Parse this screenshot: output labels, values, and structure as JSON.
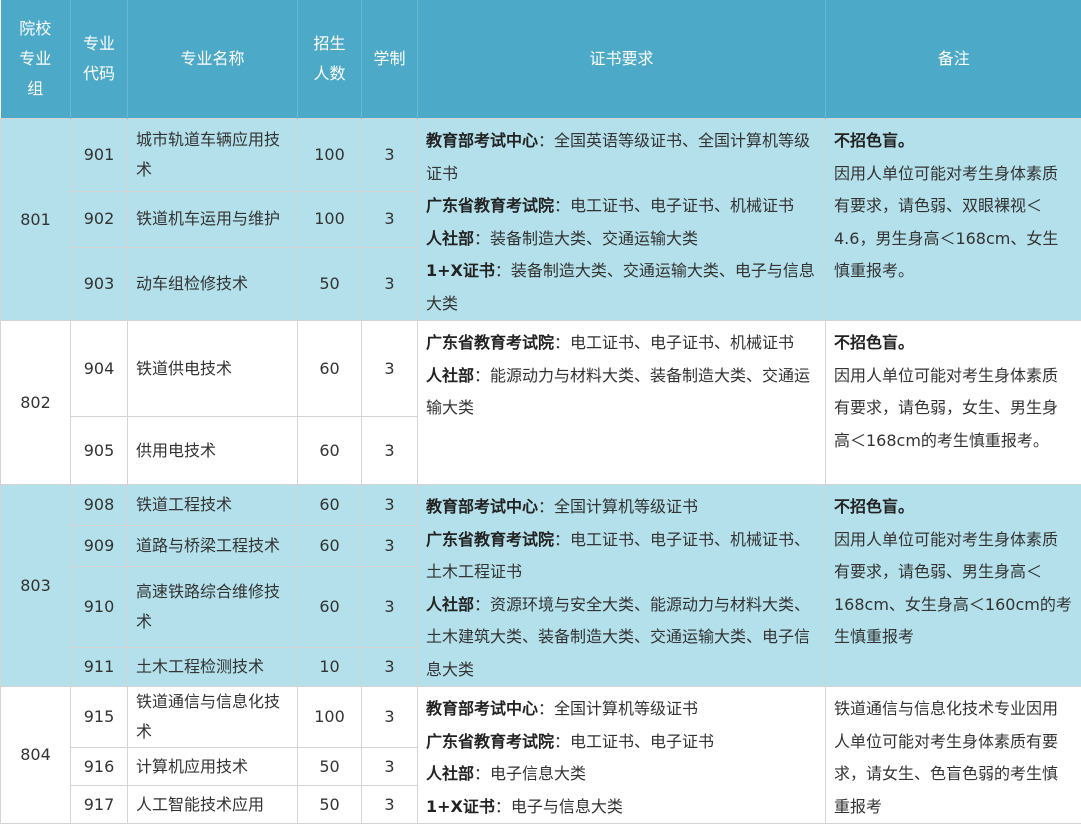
{
  "headers": {
    "group": [
      "院校",
      "专业",
      "组"
    ],
    "code": [
      "专业",
      "代码"
    ],
    "name": "专业名称",
    "enroll": [
      "招生",
      "人数"
    ],
    "years": "学制",
    "cert": "证书要求",
    "note": "备注"
  },
  "groups": [
    {
      "id": "801",
      "majors": [
        {
          "code": "901",
          "name": "城市轨道车辆应用技术",
          "count": "100",
          "years": "3"
        },
        {
          "code": "902",
          "name": "铁道机车运用与维护",
          "count": "100",
          "years": "3"
        },
        {
          "code": "903",
          "name": "动车组检修技术",
          "count": "50",
          "years": "3"
        }
      ],
      "cert": [
        {
          "label": "教育部考试中心",
          "text": "：全国英语等级证书、全国计算机等级证书"
        },
        {
          "label": "广东省教育考试院",
          "text": "：电工证书、电子证书、机械证书"
        },
        {
          "label": "人社部",
          "text": "：装备制造大类、交通运输大类"
        },
        {
          "label": "1+X证书",
          "text": "：装备制造大类、交通运输大类、电子与信息大类"
        }
      ],
      "note_bold": "不招色盲。",
      "note": "因用人单位可能对考生身体素质有要求，请色弱、双眼裸视＜4.6，男生身高＜168cm、女生慎重报考。"
    },
    {
      "id": "802",
      "majors": [
        {
          "code": "904",
          "name": "铁道供电技术",
          "count": "60",
          "years": "3"
        },
        {
          "code": "905",
          "name": "供用电技术",
          "count": "60",
          "years": "3"
        }
      ],
      "cert": [
        {
          "label": "广东省教育考试院",
          "text": "：电工证书、电子证书、机械证书"
        },
        {
          "label": "人社部",
          "text": "：能源动力与材料大类、装备制造大类、交通运输大类"
        }
      ],
      "note_bold": "不招色盲。",
      "note": "因用人单位可能对考生身体素质有要求，请色弱，女生、男生身高＜168cm的考生慎重报考。"
    },
    {
      "id": "803",
      "majors": [
        {
          "code": "908",
          "name": "铁道工程技术",
          "count": "60",
          "years": "3"
        },
        {
          "code": "909",
          "name": "道路与桥梁工程技术",
          "count": "60",
          "years": "3"
        },
        {
          "code": "910",
          "name": "高速铁路综合维修技术",
          "count": "60",
          "years": "3"
        },
        {
          "code": "911",
          "name": "土木工程检测技术",
          "count": "10",
          "years": "3"
        }
      ],
      "cert": [
        {
          "label": "教育部考试中心",
          "text": "：全国计算机等级证书"
        },
        {
          "label": "广东省教育考试院",
          "text": "：电工证书、电子证书、机械证书、土木工程证书"
        },
        {
          "label": "人社部",
          "text": "：资源环境与安全大类、能源动力与材料大类、土木建筑大类、装备制造大类、交通运输大类、电子信息大类"
        }
      ],
      "note_bold": "不招色盲。",
      "note": "因用人单位可能对考生身体素质有要求，请色弱、男生身高＜168cm、女生身高＜160cm的考生慎重报考"
    },
    {
      "id": "804",
      "majors": [
        {
          "code": "915",
          "name": "铁道通信与信息化技术",
          "count": "100",
          "years": "3"
        },
        {
          "code": "916",
          "name": "计算机应用技术",
          "count": "50",
          "years": "3"
        },
        {
          "code": "917",
          "name": "人工智能技术应用",
          "count": "50",
          "years": "3"
        }
      ],
      "cert": [
        {
          "label": "教育部考试中心",
          "text": "：全国计算机等级证书"
        },
        {
          "label": "广东省教育考试院",
          "text": "：电工证书、电子证书"
        },
        {
          "label": "人社部",
          "text": "：电子信息大类"
        },
        {
          "label": "1+X证书",
          "text": "：电子与信息大类"
        }
      ],
      "note_bold": "",
      "note": "铁道通信与信息化技术专业因用人单位可能对考生身体素质有要求，请女生、色盲色弱的考生慎重报考"
    }
  ]
}
